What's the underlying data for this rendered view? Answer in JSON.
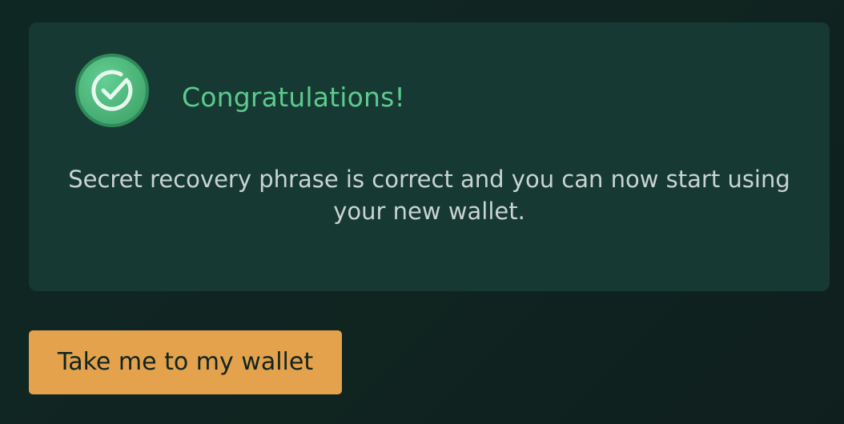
{
  "success_card": {
    "icon": "circle-check-icon",
    "title": "Congratulations!",
    "message": "Secret recovery phrase is correct and you can now start using your new wallet."
  },
  "actions": {
    "primary_label": "Take me to my wallet"
  },
  "colors": {
    "background": "#102521",
    "card": "#173933",
    "accent_green": "#5ccb8d",
    "body_text": "#c9d4d1",
    "button": "#e3a24b",
    "button_text": "#102421"
  }
}
